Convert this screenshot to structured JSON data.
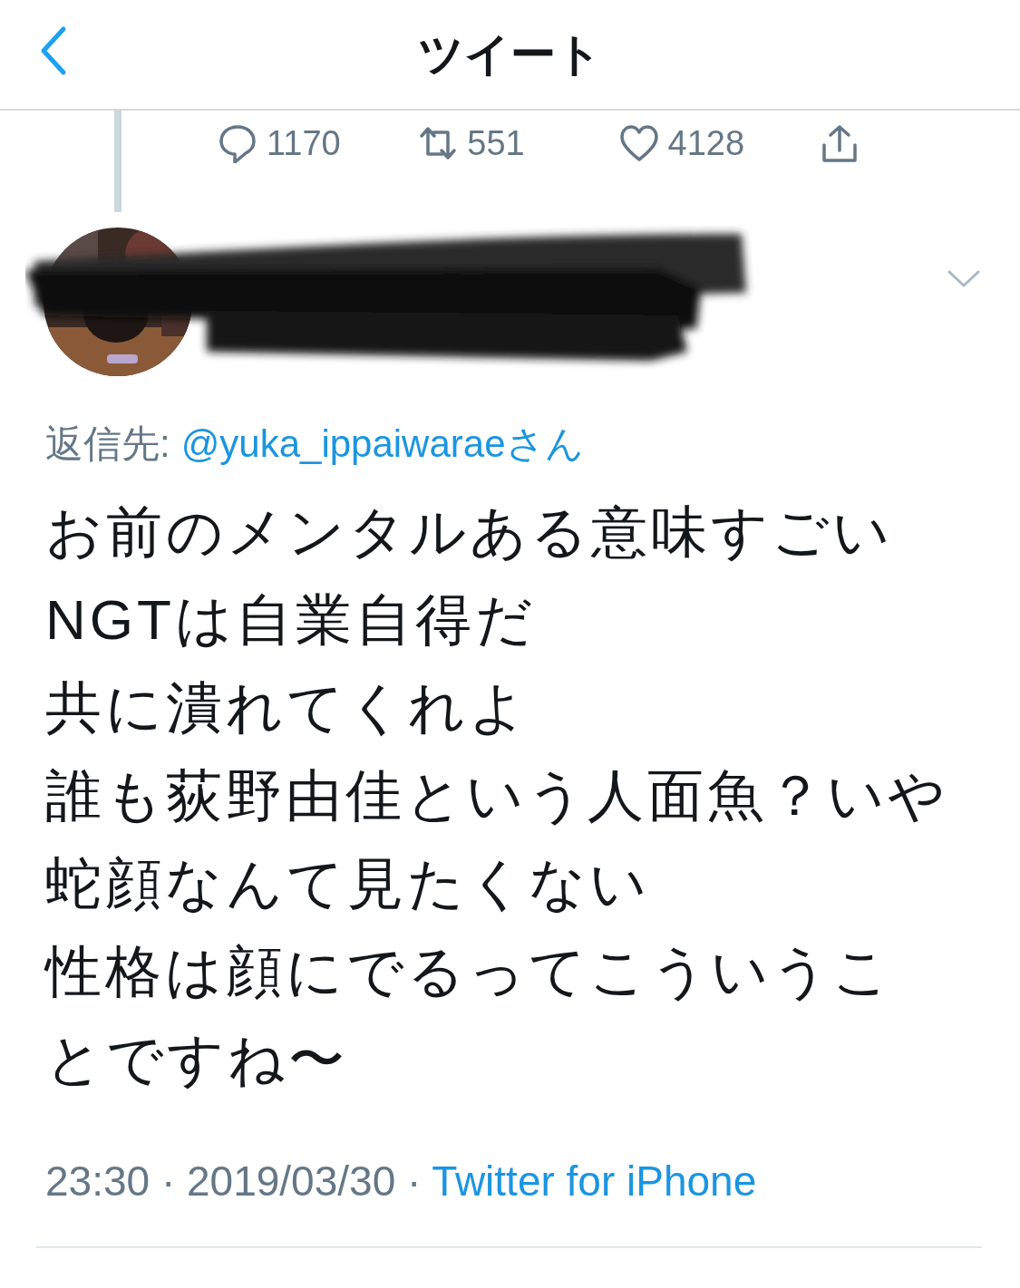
{
  "header": {
    "back_icon": true,
    "title": "ツイート"
  },
  "parent_actions": [
    {
      "kind": "reply",
      "count": "1170"
    },
    {
      "kind": "retweet",
      "count": "551"
    },
    {
      "kind": "like",
      "count": "4128"
    },
    {
      "kind": "share"
    }
  ],
  "author": {
    "name_redacted": true
  },
  "reply_to": {
    "label": "返信先:",
    "handle": "@yuka_ippaiwarae",
    "suffix": "さん"
  },
  "text_lines": [
    "お前のメンタルある意味すごい",
    "NGTは自業自得だ",
    "共に潰れてくれよ",
    "誰も荻野由佳という人面魚？いや蛇顔なんて見たくない",
    "性格は顔にでるってこういうことですね〜"
  ],
  "meta": {
    "time": "23:30",
    "separator": "·",
    "date": "2019/03/30",
    "source": "Twitter for iPhone"
  }
}
